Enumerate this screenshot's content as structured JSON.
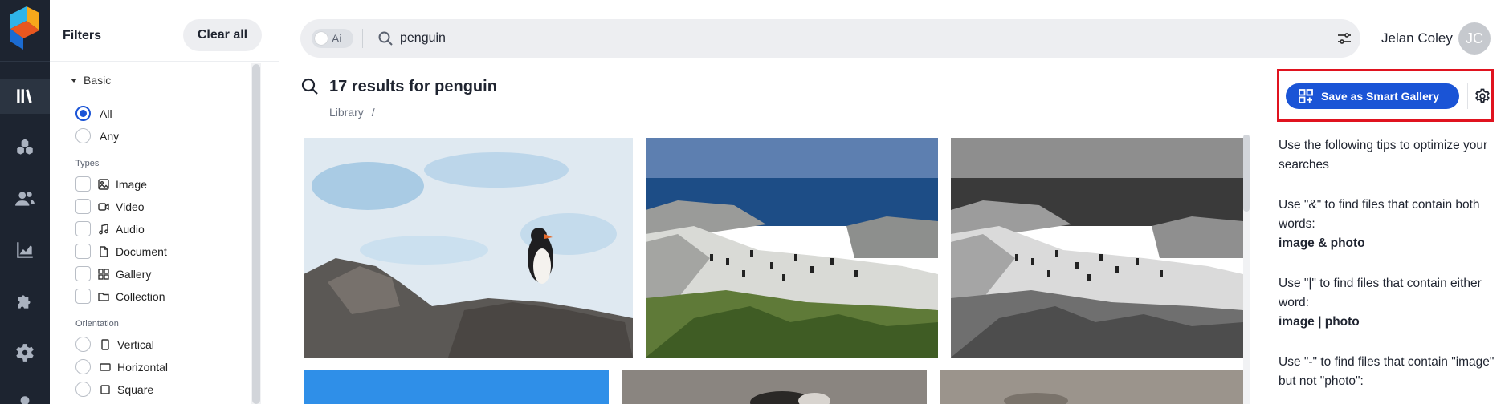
{
  "rail": {
    "items": [
      {
        "name": "library-icon",
        "active": true
      },
      {
        "name": "assets-icon",
        "active": false
      },
      {
        "name": "users-icon",
        "active": false
      },
      {
        "name": "analytics-icon",
        "active": false
      },
      {
        "name": "integrations-icon",
        "active": false
      },
      {
        "name": "settings-icon",
        "active": false
      },
      {
        "name": "profile-icon",
        "active": false
      }
    ]
  },
  "filters": {
    "title": "Filters",
    "clear_all": "Clear all",
    "basic": "Basic",
    "match": [
      {
        "label": "All",
        "selected": true
      },
      {
        "label": "Any",
        "selected": false
      }
    ],
    "types_label": "Types",
    "types": [
      {
        "label": "Image",
        "icon": "image-icon"
      },
      {
        "label": "Video",
        "icon": "video-icon"
      },
      {
        "label": "Audio",
        "icon": "audio-icon"
      },
      {
        "label": "Document",
        "icon": "document-icon"
      },
      {
        "label": "Gallery",
        "icon": "gallery-icon"
      },
      {
        "label": "Collection",
        "icon": "collection-icon"
      }
    ],
    "orientation_label": "Orientation",
    "orientation": [
      {
        "label": "Vertical",
        "icon": "vertical-icon"
      },
      {
        "label": "Horizontal",
        "icon": "horizontal-icon"
      },
      {
        "label": "Square",
        "icon": "square-icon"
      }
    ]
  },
  "search": {
    "ai_label": "Ai",
    "query": "penguin"
  },
  "user": {
    "name": "Jelan Coley",
    "initials": "JC"
  },
  "results": {
    "title": "17 results for penguin",
    "breadcrumb": "Library",
    "breadcrumb_sep": "/"
  },
  "actions": {
    "save_smart_gallery": "Save as Smart Gallery"
  },
  "tips": {
    "intro": "Use the following tips to optimize your searches",
    "and_text": "Use \"&\" to find files that contain both words:",
    "and_example": "image & photo",
    "or_text": "Use \"|\" to find files that contain either word:",
    "or_example": "image | photo",
    "not_text": "Use \"-\" to find files that contain \"image\" but not \"photo\":"
  },
  "colors": {
    "accent": "#1a54d6",
    "rail_bg": "#1d2430",
    "highlight": "#e0131f"
  }
}
